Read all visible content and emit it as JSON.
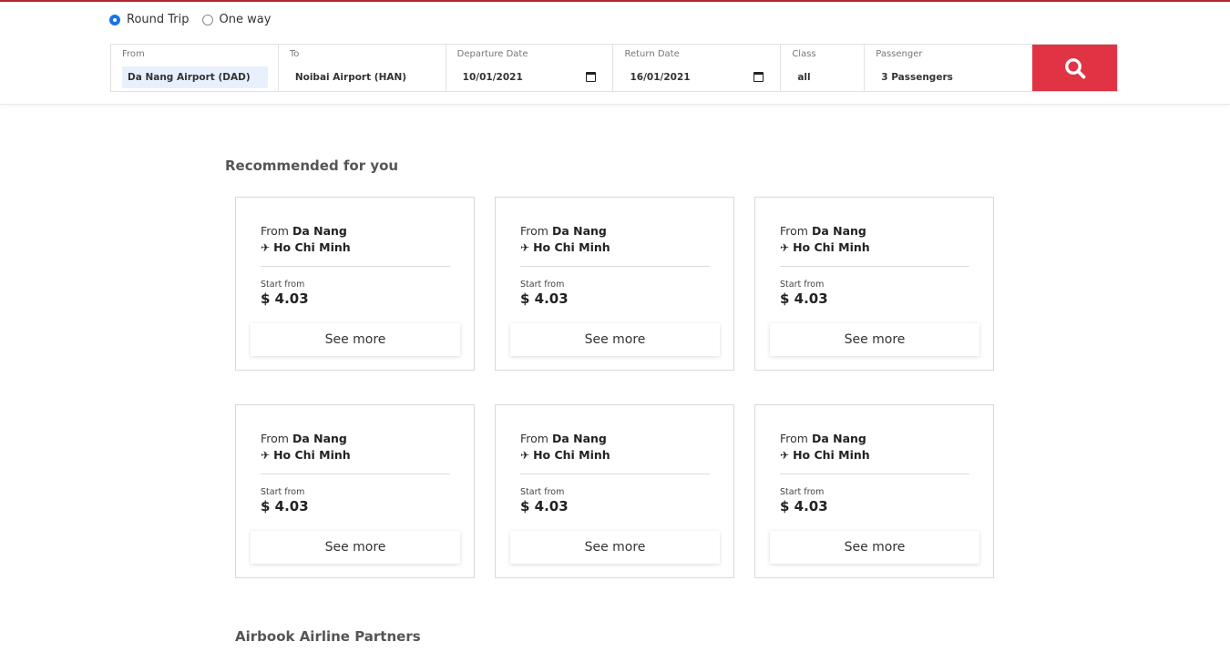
{
  "trip_type": {
    "round_trip": "Round Trip",
    "one_way": "One way",
    "selected": "round_trip"
  },
  "search": {
    "from": {
      "label": "From",
      "value": "Da Nang Airport (DAD)"
    },
    "to": {
      "label": "To",
      "value": "Noibai Airport (HAN)"
    },
    "departure": {
      "label": "Departure Date",
      "value": "10/01/2021"
    },
    "return": {
      "label": "Return Date",
      "value": "16/01/2021"
    },
    "class": {
      "label": "Class",
      "value": "all"
    },
    "passenger": {
      "label": "Passenger",
      "value": "3 Passengers"
    },
    "button_icon": "search-icon"
  },
  "recommended": {
    "title": "Recommended for you",
    "cards": [
      {
        "from_prefix": "From",
        "from_city": "Da Nang",
        "to_city": "Ho Chi Minh",
        "start_label": "Start from",
        "price": "$ 4.03",
        "button": "See more"
      },
      {
        "from_prefix": "From",
        "from_city": "Da Nang",
        "to_city": "Ho Chi Minh",
        "start_label": "Start from",
        "price": "$ 4.03",
        "button": "See more"
      },
      {
        "from_prefix": "From",
        "from_city": "Da Nang",
        "to_city": "Ho Chi Minh",
        "start_label": "Start from",
        "price": "$ 4.03",
        "button": "See more"
      },
      {
        "from_prefix": "From",
        "from_city": "Da Nang",
        "to_city": "Ho Chi Minh",
        "start_label": "Start from",
        "price": "$ 4.03",
        "button": "See more"
      },
      {
        "from_prefix": "From",
        "from_city": "Da Nang",
        "to_city": "Ho Chi Minh",
        "start_label": "Start from",
        "price": "$ 4.03",
        "button": "See more"
      },
      {
        "from_prefix": "From",
        "from_city": "Da Nang",
        "to_city": "Ho Chi Minh",
        "start_label": "Start from",
        "price": "$ 4.03",
        "button": "See more"
      }
    ]
  },
  "partners": {
    "title": "Airbook Airline Partners"
  },
  "colors": {
    "accent": "#e03444",
    "brand_line": "#b3262d",
    "radio_selected": "#1a73e8"
  }
}
